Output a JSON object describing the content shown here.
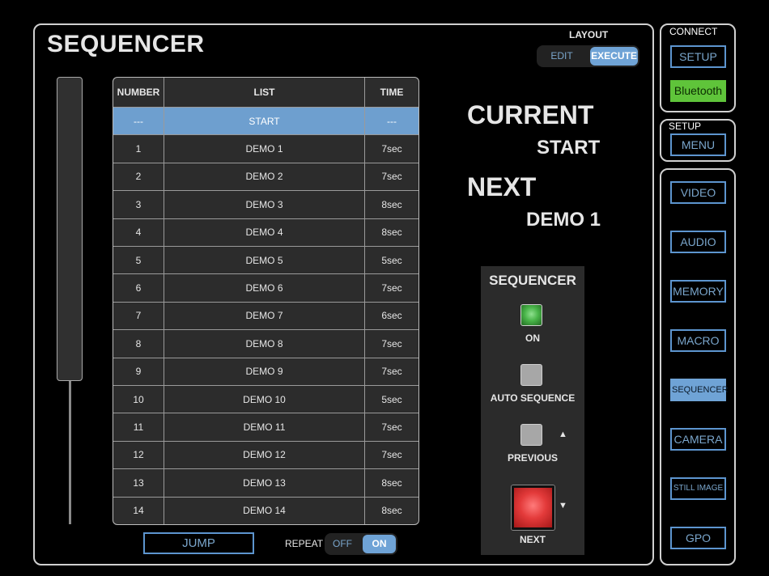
{
  "app": {
    "title": "SEQUENCER"
  },
  "layout": {
    "label": "LAYOUT",
    "edit": "EDIT",
    "execute": "EXECUTE",
    "selected": "EXECUTE"
  },
  "connect": {
    "label": "CONNECT",
    "setup": "SETUP",
    "bluetooth": "Bluetooth"
  },
  "setup": {
    "label": "SETUP",
    "menu": "MENU"
  },
  "nav": {
    "items": [
      "VIDEO",
      "AUDIO",
      "MEMORY",
      "MACRO",
      "SEQUENCER",
      "CAMERA",
      "STILL IMAGE",
      "GPO"
    ],
    "active": "SEQUENCER"
  },
  "table": {
    "headers": {
      "number": "NUMBER",
      "list": "LIST",
      "time": "TIME"
    },
    "rows": [
      {
        "number": "---",
        "list": "START",
        "time": "---",
        "selected": true
      },
      {
        "number": "1",
        "list": "DEMO 1",
        "time": "7sec"
      },
      {
        "number": "2",
        "list": "DEMO 2",
        "time": "7sec"
      },
      {
        "number": "3",
        "list": "DEMO 3",
        "time": "8sec"
      },
      {
        "number": "4",
        "list": "DEMO 4",
        "time": "8sec"
      },
      {
        "number": "5",
        "list": "DEMO 5",
        "time": "5sec"
      },
      {
        "number": "6",
        "list": "DEMO 6",
        "time": "7sec"
      },
      {
        "number": "7",
        "list": "DEMO 7",
        "time": "6sec"
      },
      {
        "number": "8",
        "list": "DEMO 8",
        "time": "7sec"
      },
      {
        "number": "9",
        "list": "DEMO 9",
        "time": "7sec"
      },
      {
        "number": "10",
        "list": "DEMO 10",
        "time": "5sec"
      },
      {
        "number": "11",
        "list": "DEMO 11",
        "time": "7sec"
      },
      {
        "number": "12",
        "list": "DEMO 12",
        "time": "7sec"
      },
      {
        "number": "13",
        "list": "DEMO 13",
        "time": "8sec"
      },
      {
        "number": "14",
        "list": "DEMO 14",
        "time": "8sec"
      }
    ]
  },
  "controls": {
    "jump": "JUMP",
    "repeat_label": "REPEAT",
    "repeat_off": "OFF",
    "repeat_on": "ON",
    "repeat_selected": "ON"
  },
  "status": {
    "current_label": "CURRENT",
    "current_value": "START",
    "next_label": "NEXT",
    "next_value": "DEMO 1"
  },
  "sequencer_box": {
    "title": "SEQUENCER",
    "on_label": "ON",
    "auto_label": "AUTO SEQUENCE",
    "previous_label": "PREVIOUS",
    "next_label": "NEXT",
    "up_arrow": "▲",
    "down_arrow": "▼"
  },
  "colors": {
    "accent": "#6fa3d6",
    "on_led": "#49b449",
    "next_button": "#e33a3a",
    "bluetooth": "#5fc43a"
  }
}
